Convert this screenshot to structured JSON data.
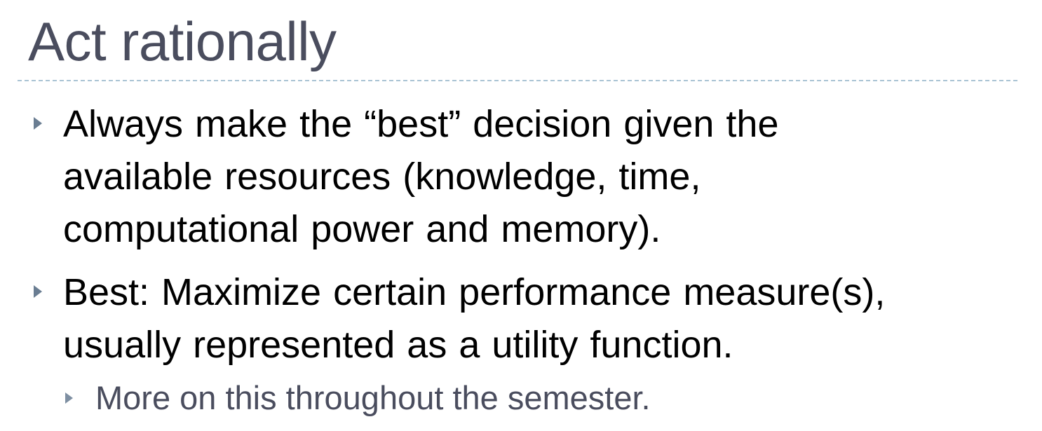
{
  "slide": {
    "title": "Act rationally",
    "bullets": [
      {
        "lines": [
          "Always make the “best” decision given the",
          "available resources (knowledge, time,",
          "computational power and memory)."
        ]
      },
      {
        "lines": [
          "Best: Maximize certain performance measure(s),",
          "usually represented as a utility function."
        ]
      }
    ],
    "sub_bullets": [
      {
        "text": "More on this throughout the semester."
      }
    ]
  },
  "colors": {
    "title": "#4a4d5e",
    "body_text": "#000000",
    "sub_text": "#4a4d5e",
    "bullet_arrow": "#6a7d92",
    "divider": "#a9c3d4"
  },
  "icons": {
    "bullet": "triangle-right-icon"
  }
}
